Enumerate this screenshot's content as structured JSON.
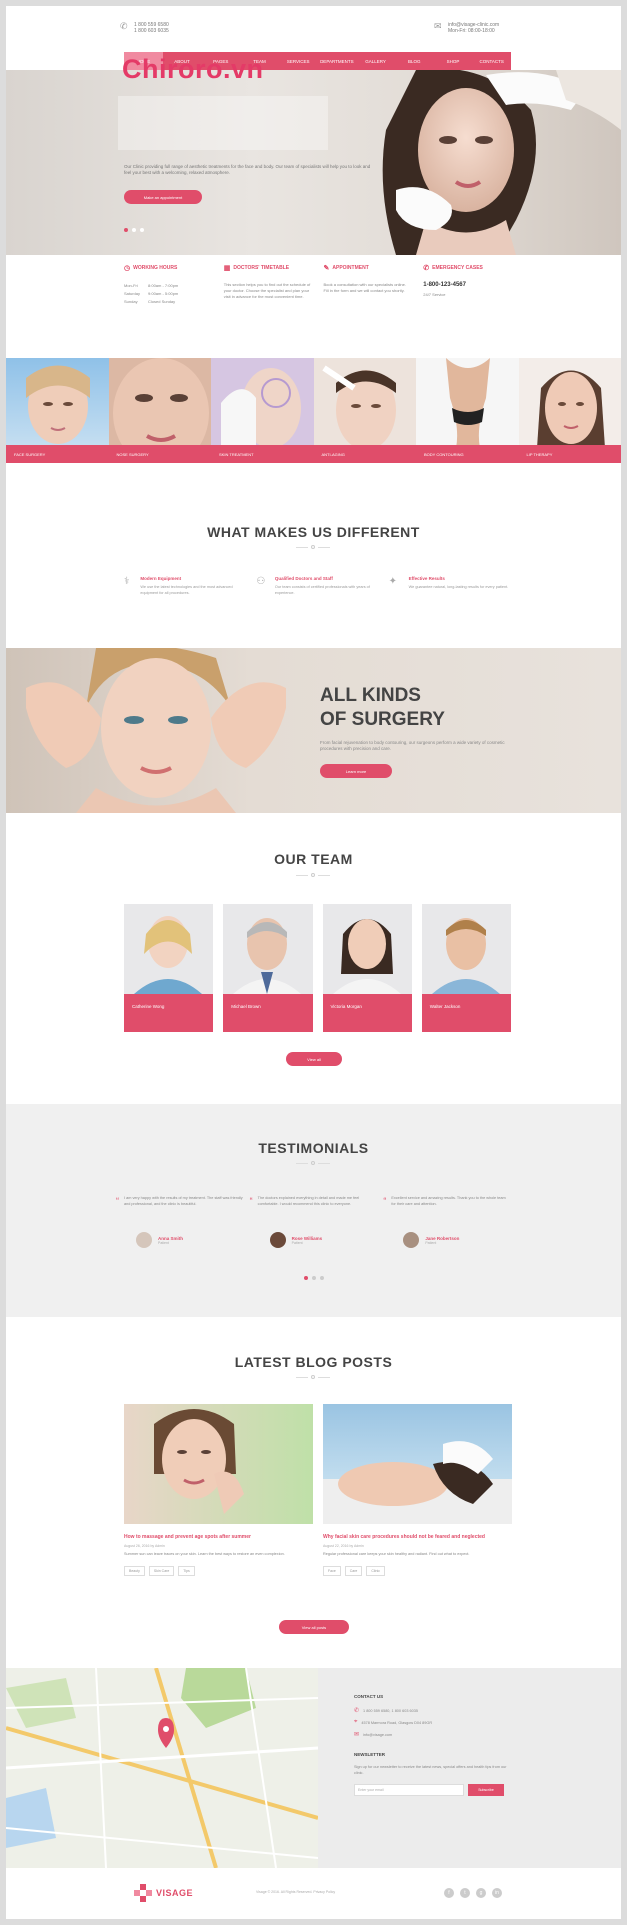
{
  "watermark": "Chiroro.vn",
  "topbar": {
    "left_lines": [
      "1 800 559 6580",
      "1 800 603 6035"
    ],
    "right_lines": [
      "info@visage-clinic.com",
      "Mon-Fri: 08:00-18:00"
    ]
  },
  "nav": {
    "items": [
      "Home",
      "About",
      "Pages",
      "Team",
      "Services",
      "Departments",
      "Gallery",
      "Blog",
      "Shop",
      "Contacts"
    ]
  },
  "hero": {
    "description": "Our Clinic providing full range of aesthetic treatments for the face and body. Our team of specialists will help you to look and feel your best with a welcoming, relaxed atmosphere.",
    "cta": "Make an appointment"
  },
  "info": {
    "hours": {
      "title": "Working Hours",
      "rows": [
        [
          "Mon-Fri",
          "8:00am - 7:00pm"
        ],
        [
          "Saturday",
          "9:00am - 5:00pm"
        ],
        [
          "Sunday",
          "Closed Sunday"
        ]
      ]
    },
    "doctors": {
      "title": "Doctors' Timetable",
      "text": "This section helps you to find out the schedule of your doctor. Choose the specialist and plan your visit in advance for the most convenient time."
    },
    "appointment": {
      "title": "Appointment",
      "text": "Book a consultation with our specialists online. Fill in the form and we will contact you shortly."
    },
    "emergency": {
      "title": "Emergency Cases",
      "phone": "1-800-123-4567",
      "text": "24/7 Service"
    }
  },
  "procedures": [
    "Face Surgery",
    "Nose Surgery",
    "Skin Treatment",
    "Anti-Aging",
    "Body Contouring",
    "Lip Therapy"
  ],
  "different": {
    "title": "WHAT MAKES US DIFFERENT",
    "items": [
      {
        "title": "Modern Equipment",
        "text": "We use the latest technologies and the most advanced equipment for all procedures."
      },
      {
        "title": "Qualified Doctors and Staff",
        "text": "Our team consists of certified professionals with years of experience."
      },
      {
        "title": "Effective Results",
        "text": "We guarantee natural, long-lasting results for every patient."
      }
    ]
  },
  "surgery": {
    "line1": "ALL KINDS",
    "line2": "OF SURGERY",
    "text": "From facial rejuvenation to body contouring, our surgeons perform a wide variety of cosmetic procedures with precision and care.",
    "button": "Learn more"
  },
  "team": {
    "title": "OUR TEAM",
    "members": [
      "Catherine Wong",
      "Michael Brown",
      "Victoria Morgan",
      "Walter Jackson"
    ],
    "button": "View all"
  },
  "testimonials": {
    "title": "TESTIMONIALS",
    "items": [
      {
        "text": "I am very happy with the results of my treatment. The staff was friendly and professional, and the clinic is beautiful.",
        "name": "Anna Smith",
        "role": "Patient"
      },
      {
        "text": "The doctors explained everything in detail and made me feel comfortable. I would recommend this clinic to everyone.",
        "name": "Rose Williams",
        "role": "Patient"
      },
      {
        "text": "Excellent service and amazing results. Thank you to the whole team for their care and attention.",
        "name": "Jane Robertson",
        "role": "Patient"
      }
    ]
  },
  "blog": {
    "title": "LATEST BLOG POSTS",
    "posts": [
      {
        "title": "How to massage and prevent age spots after summer",
        "meta": "August 26, 2016 by Admin",
        "excerpt": "Summer sun can leave traces on your skin. Learn the best ways to restore an even complexion.",
        "tags": [
          "Beauty",
          "Skin Care",
          "Tips"
        ]
      },
      {
        "title": "Why facial skin care procedures should not be feared and neglected",
        "meta": "August 22, 2016 by Admin",
        "excerpt": "Regular professional care keeps your skin healthy and radiant. Find out what to expect.",
        "tags": [
          "Face",
          "Care",
          "Clinic"
        ]
      }
    ],
    "button": "View all posts"
  },
  "contact": {
    "title": "Contact us",
    "phone": "1 800 559 6580, 1 800 603 6035",
    "address": "4578 Marmora Road, Glasgow D04 89GR",
    "email": "info@visage.com",
    "newsletter_title": "Newsletter",
    "newsletter_text": "Sign up for our newsletter to receive the latest news, special offers and health tips from our clinic.",
    "placeholder": "Enter your email",
    "subscribe": "Subscribe"
  },
  "footer": {
    "brand": "VISAGE",
    "copy": "Visage © 2016. All Rights Reserved. Privacy Policy",
    "social": [
      "f",
      "t",
      "g",
      "in"
    ]
  },
  "colors": {
    "accent": "#e04d6a",
    "accent_light": "#f08aa0"
  }
}
